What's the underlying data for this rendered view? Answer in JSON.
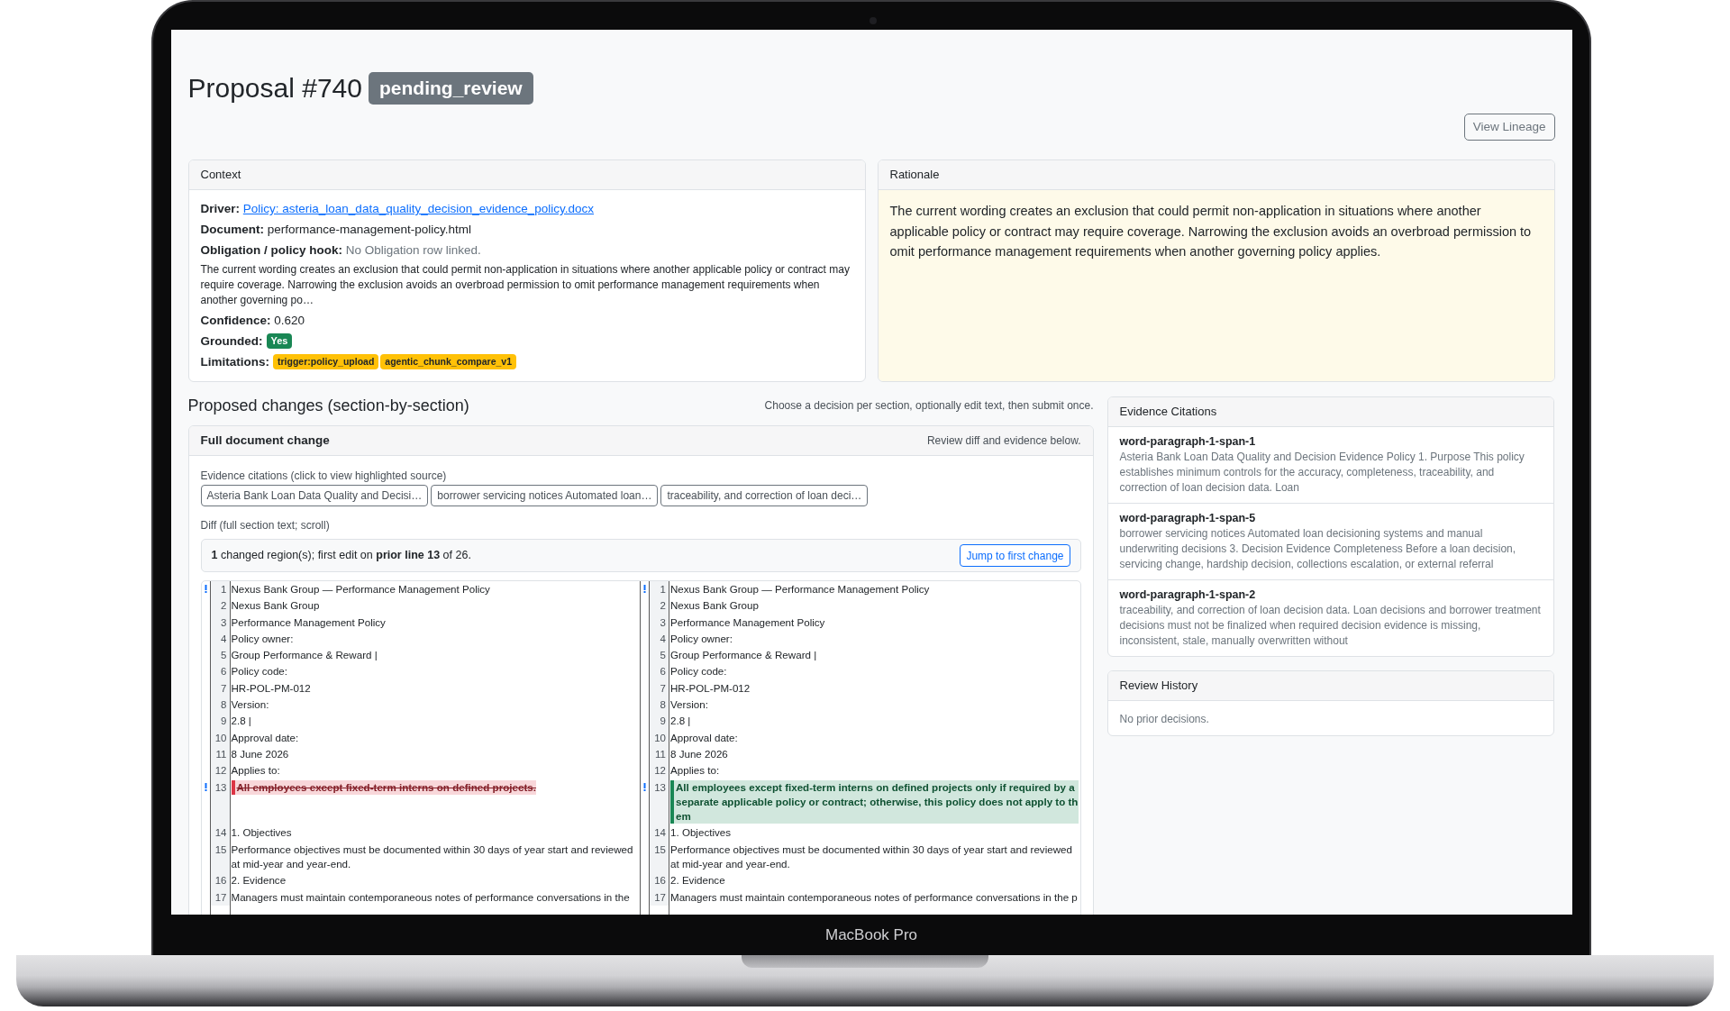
{
  "device": {
    "label": "MacBook Pro"
  },
  "header": {
    "title": "Proposal #740",
    "status": "pending_review",
    "lineage_button": "View Lineage"
  },
  "context": {
    "title": "Context",
    "fields": [
      {
        "kind": "link",
        "label": "Driver:",
        "value": "Policy: asteria_loan_data_quality_decision_evidence_policy.docx"
      },
      {
        "kind": "text",
        "label": "Document:",
        "value": "performance-management-policy.html"
      },
      {
        "kind": "muted",
        "label": "Obligation / policy hook:",
        "value": "No Obligation row linked."
      },
      {
        "kind": "paragraph",
        "value": "The current wording creates an exclusion that could permit non-application in situations where another applicable policy or contract may require coverage. Narrowing the exclusion avoids an overbroad permission to omit performance management requirements when another governing po…"
      },
      {
        "kind": "text",
        "label": "Confidence:",
        "value": "0.620"
      },
      {
        "kind": "success",
        "label": "Grounded:",
        "badges": [
          "Yes"
        ]
      },
      {
        "kind": "warning",
        "label": "Limitations:",
        "badges": [
          "trigger:policy_upload",
          "agentic_chunk_compare_v1"
        ]
      }
    ]
  },
  "rationale": {
    "title": "Rationale",
    "text": "The current wording creates an exclusion that could permit non-application in situations where another applicable policy or contract may require coverage. Narrowing the exclusion avoids an overbroad permission to omit performance management requirements when another governing policy applies."
  },
  "proposed_changes": {
    "heading": "Proposed changes (section-by-section)",
    "hint": "Choose a decision per section, optionally edit text, then submit once.",
    "section": {
      "title": "Full document change",
      "note": "Review diff and evidence below.",
      "citations_label": "Evidence citations (click to view highlighted source)",
      "citation_chips": [
        "Asteria Bank Loan Data Quality and Decisi…",
        "borrower servicing notices Automated loan…",
        "traceability, and correction of loan deci…"
      ],
      "diff_label": "Diff (full section text; scroll)",
      "summary": "**1** changed region(s); first edit on **prior line 13** of 26.",
      "jump_button": "Jump to first change",
      "diff_rows": [
        {
          "left": {
            "number": "1",
            "text": "Nexus Bank Group — Performance Management Policy",
            "kind": "same",
            "marker": true
          },
          "right": {
            "number": "1",
            "text": "Nexus Bank Group — Performance Management Policy",
            "kind": "same",
            "marker": true
          }
        },
        {
          "left": {
            "number": "2",
            "text": "Nexus Bank Group",
            "kind": "same",
            "marker": false
          },
          "right": {
            "number": "2",
            "text": "Nexus Bank Group",
            "kind": "same",
            "marker": false
          }
        },
        {
          "left": {
            "number": "3",
            "text": "Performance Management Policy",
            "kind": "same",
            "marker": false
          },
          "right": {
            "number": "3",
            "text": "Performance Management Policy",
            "kind": "same",
            "marker": false
          }
        },
        {
          "left": {
            "number": "4",
            "text": "Policy owner:",
            "kind": "same",
            "marker": false
          },
          "right": {
            "number": "4",
            "text": "Policy owner:",
            "kind": "same",
            "marker": false
          }
        },
        {
          "left": {
            "number": "5",
            "text": "Group Performance & Reward |",
            "kind": "same",
            "marker": false
          },
          "right": {
            "number": "5",
            "text": "Group Performance & Reward |",
            "kind": "same",
            "marker": false
          }
        },
        {
          "left": {
            "number": "6",
            "text": "Policy code:",
            "kind": "same",
            "marker": false
          },
          "right": {
            "number": "6",
            "text": "Policy code:",
            "kind": "same",
            "marker": false
          }
        },
        {
          "left": {
            "number": "7",
            "text": "HR-POL-PM-012",
            "kind": "same",
            "marker": false
          },
          "right": {
            "number": "7",
            "text": "HR-POL-PM-012",
            "kind": "same",
            "marker": false
          }
        },
        {
          "left": {
            "number": "8",
            "text": "Version:",
            "kind": "same",
            "marker": false
          },
          "right": {
            "number": "8",
            "text": "Version:",
            "kind": "same",
            "marker": false
          }
        },
        {
          "left": {
            "number": "9",
            "text": "2.8 |",
            "kind": "same",
            "marker": false
          },
          "right": {
            "number": "9",
            "text": "2.8 |",
            "kind": "same",
            "marker": false
          }
        },
        {
          "left": {
            "number": "10",
            "text": "Approval date:",
            "kind": "same",
            "marker": false
          },
          "right": {
            "number": "10",
            "text": "Approval date:",
            "kind": "same",
            "marker": false
          }
        },
        {
          "left": {
            "number": "11",
            "text": "8 June 2026",
            "kind": "same",
            "marker": false
          },
          "right": {
            "number": "11",
            "text": "8 June 2026",
            "kind": "same",
            "marker": false
          }
        },
        {
          "left": {
            "number": "12",
            "text": "Applies to:",
            "kind": "same",
            "marker": false
          },
          "right": {
            "number": "12",
            "text": "Applies to:",
            "kind": "same",
            "marker": false
          }
        },
        {
          "left": {
            "number": "13",
            "text": "All employees except fixed-term interns on defined projects.",
            "kind": "deleted",
            "marker": true
          },
          "right": {
            "number": "13",
            "text": "All employees except fixed-term interns on defined projects only if required by a separate applicable policy or contract; otherwise, this policy does not apply to them",
            "kind": "added",
            "marker": true
          }
        },
        {
          "left": {
            "number": "14",
            "text": "1. Objectives",
            "kind": "same",
            "marker": false
          },
          "right": {
            "number": "14",
            "text": "1. Objectives",
            "kind": "same",
            "marker": false
          }
        },
        {
          "left": {
            "number": "15",
            "text": "Performance objectives must be documented within 30 days of year start and reviewed at mid-year and year-end.",
            "kind": "same",
            "marker": false
          },
          "right": {
            "number": "15",
            "text": "Performance objectives must be documented within 30 days of year start and reviewed at mid-year and year-end.",
            "kind": "same",
            "marker": false
          }
        },
        {
          "left": {
            "number": "16",
            "text": "2. Evidence",
            "kind": "same",
            "marker": false
          },
          "right": {
            "number": "16",
            "text": "2. Evidence",
            "kind": "same",
            "marker": false
          }
        },
        {
          "left": {
            "number": "17",
            "text": "Managers must maintain contemporaneous notes of performance conversations in the",
            "kind": "same",
            "marker": false
          },
          "right": {
            "number": "17",
            "text": "Managers must maintain contemporaneous notes of performance conversations in the p",
            "kind": "same",
            "marker": false
          }
        }
      ]
    }
  },
  "evidence_citations": {
    "title": "Evidence Citations",
    "items": [
      {
        "id": "word-paragraph-1-span-1",
        "text": "Asteria Bank Loan Data Quality and Decision Evidence Policy 1. Purpose This policy establishes minimum controls for the accuracy, completeness, traceability, and correction of loan decision data. Loan"
      },
      {
        "id": "word-paragraph-1-span-5",
        "text": "borrower servicing notices Automated loan decisioning systems and manual underwriting decisions 3. Decision Evidence Completeness Before a loan decision, servicing change, hardship decision, collections escalation, or external referral"
      },
      {
        "id": "word-paragraph-1-span-2",
        "text": "traceability, and correction of loan decision data. Loan decisions and borrower treatment decisions must not be finalized when required decision evidence is missing, inconsistent, stale, manually overwritten without"
      }
    ]
  },
  "review_history": {
    "title": "Review History",
    "empty_text": "No prior decisions."
  }
}
